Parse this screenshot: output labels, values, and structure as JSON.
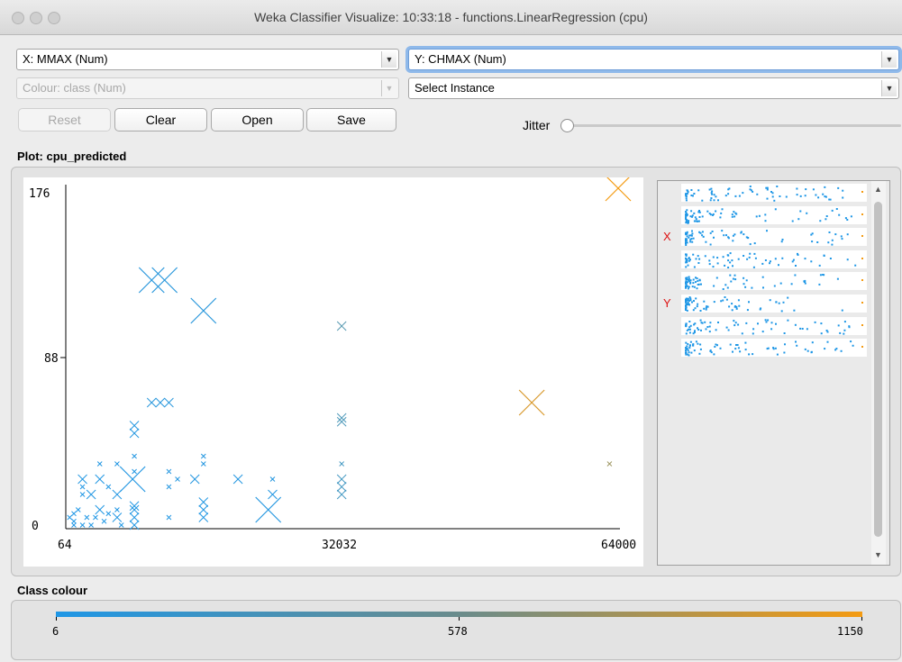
{
  "window": {
    "title": "Weka Classifier Visualize: 10:33:18 - functions.LinearRegression (cpu)"
  },
  "controls": {
    "x_axis": "X: MMAX (Num)",
    "y_axis": "Y: CHMAX (Num)",
    "colour": "Colour: class (Num)",
    "select_instance": "Select Instance",
    "reset_label": "Reset",
    "clear_label": "Clear",
    "open_label": "Open",
    "save_label": "Save",
    "jitter_label": "Jitter",
    "jitter_value": 0
  },
  "plot": {
    "heading": "Plot: cpu_predicted"
  },
  "chart_data": {
    "type": "scatter",
    "xlim": [
      64,
      64000
    ],
    "ylim": [
      0,
      176
    ],
    "x_ticks": [
      "64",
      "32032",
      "64000"
    ],
    "y_ticks": [
      "176",
      "88",
      "0"
    ],
    "colour_range": [
      6,
      1150
    ],
    "points": [
      [
        64000,
        176,
        1150,
        "l"
      ],
      [
        54000,
        64,
        1000,
        "l"
      ],
      [
        63000,
        32,
        700,
        "s"
      ],
      [
        10000,
        128,
        60,
        "l"
      ],
      [
        11500,
        128,
        60,
        "l"
      ],
      [
        16000,
        112,
        60,
        "l"
      ],
      [
        32000,
        104,
        300,
        "m"
      ],
      [
        10000,
        64,
        60,
        "m"
      ],
      [
        11000,
        64,
        60,
        "m"
      ],
      [
        12000,
        64,
        60,
        "m"
      ],
      [
        7800,
        24,
        30,
        "l"
      ],
      [
        3000,
        16,
        20,
        "m"
      ],
      [
        4000,
        8,
        20,
        "m"
      ],
      [
        2000,
        24,
        30,
        "m"
      ],
      [
        32000,
        56,
        250,
        "m"
      ],
      [
        32000,
        54,
        250,
        "m"
      ],
      [
        23500,
        8,
        40,
        "l"
      ],
      [
        24000,
        16,
        30,
        "m"
      ],
      [
        20000,
        24,
        40,
        "m"
      ],
      [
        15000,
        24,
        40,
        "m"
      ],
      [
        13000,
        24,
        40,
        "s"
      ],
      [
        16000,
        8,
        20,
        "m"
      ],
      [
        16000,
        4,
        20,
        "m"
      ],
      [
        16000,
        12,
        30,
        "m"
      ],
      [
        8000,
        48,
        40,
        "m"
      ],
      [
        8000,
        52,
        40,
        "m"
      ],
      [
        8000,
        0,
        20,
        "m"
      ],
      [
        8000,
        4,
        20,
        "m"
      ],
      [
        8000,
        8,
        20,
        "m"
      ],
      [
        8000,
        10,
        20,
        "m"
      ],
      [
        6000,
        32,
        30,
        "s"
      ],
      [
        6000,
        16,
        20,
        "m"
      ],
      [
        6000,
        4,
        20,
        "m"
      ],
      [
        4000,
        24,
        20,
        "m"
      ],
      [
        4000,
        32,
        30,
        "s"
      ],
      [
        2000,
        0,
        10,
        "s"
      ],
      [
        1000,
        2,
        10,
        "s"
      ],
      [
        3000,
        0,
        10,
        "s"
      ],
      [
        4500,
        2,
        10,
        "s"
      ],
      [
        5000,
        6,
        10,
        "s"
      ],
      [
        512,
        4,
        10,
        "s"
      ],
      [
        1000,
        6,
        10,
        "s"
      ],
      [
        32000,
        20,
        200,
        "m"
      ],
      [
        32000,
        24,
        200,
        "m"
      ],
      [
        32000,
        16,
        200,
        "m"
      ],
      [
        32000,
        32,
        200,
        "s"
      ],
      [
        16000,
        32,
        40,
        "s"
      ],
      [
        16000,
        36,
        40,
        "s"
      ],
      [
        12000,
        28,
        40,
        "s"
      ],
      [
        12000,
        20,
        40,
        "s"
      ],
      [
        12000,
        4,
        20,
        "s"
      ],
      [
        6000,
        8,
        20,
        "s"
      ],
      [
        8000,
        36,
        30,
        "s"
      ],
      [
        8000,
        28,
        30,
        "s"
      ],
      [
        2000,
        16,
        10,
        "s"
      ],
      [
        1500,
        8,
        10,
        "s"
      ],
      [
        2500,
        4,
        10,
        "s"
      ],
      [
        3500,
        4,
        10,
        "s"
      ],
      [
        1000,
        0,
        10,
        "s"
      ],
      [
        6500,
        0,
        10,
        "s"
      ],
      [
        24000,
        24,
        40,
        "s"
      ],
      [
        2000,
        20,
        10,
        "s"
      ],
      [
        5000,
        20,
        10,
        "s"
      ]
    ]
  },
  "attribute_panel": {
    "rows": [
      {
        "x_marker": "",
        "y_marker": ""
      },
      {
        "x_marker": "",
        "y_marker": ""
      },
      {
        "x_marker": "X",
        "y_marker": ""
      },
      {
        "x_marker": "",
        "y_marker": ""
      },
      {
        "x_marker": "",
        "y_marker": ""
      },
      {
        "x_marker": "",
        "y_marker": "Y"
      },
      {
        "x_marker": "",
        "y_marker": ""
      },
      {
        "x_marker": "",
        "y_marker": ""
      }
    ]
  },
  "class_colour": {
    "heading": "Class colour",
    "min": "6",
    "mid": "578",
    "max": "1150",
    "colors": [
      "#1f97e6",
      "#f49b12"
    ]
  }
}
